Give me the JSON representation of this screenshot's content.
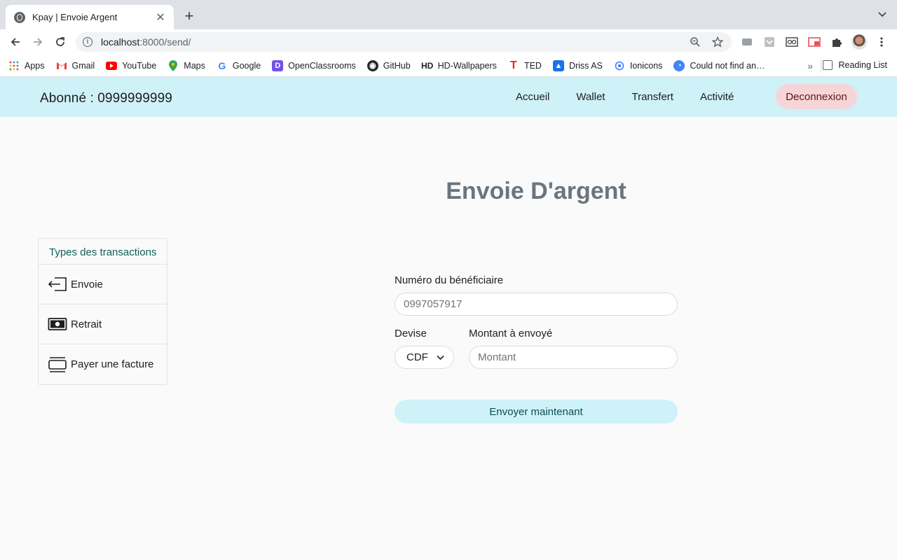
{
  "browser": {
    "tab_title": "Kpay | Envoie Argent",
    "tab_close": "✕",
    "new_tab": "+",
    "url_host": "localhost",
    "url_path": ":8000/send/",
    "bookmarks": [
      {
        "label": "Apps",
        "icon": "apps-grid-icon",
        "color": "#5f6368"
      },
      {
        "label": "Gmail",
        "icon": "gmail-icon",
        "color": "#ea4335"
      },
      {
        "label": "YouTube",
        "icon": "youtube-icon",
        "color": "#ff0000"
      },
      {
        "label": "Maps",
        "icon": "maps-icon",
        "color": "#34a853"
      },
      {
        "label": "Google",
        "icon": "google-icon",
        "color": "#4285f4"
      },
      {
        "label": "OpenClassrooms",
        "icon": "openclassrooms-icon",
        "color": "#7451eb"
      },
      {
        "label": "GitHub",
        "icon": "github-icon",
        "color": "#24292e"
      },
      {
        "label": "HD-Wallpapers",
        "icon": "hd-wallpapers-icon",
        "color": "#222222"
      },
      {
        "label": "TED",
        "icon": "ted-icon",
        "color": "#e62b1e"
      },
      {
        "label": "Driss AS",
        "icon": "driss-icon",
        "color": "#1a73e8"
      },
      {
        "label": "Ionicons",
        "icon": "ionicons-icon",
        "color": "#3880ff"
      },
      {
        "label": "Could not find an…",
        "icon": "could-not-find-icon",
        "color": "#4285f4"
      }
    ],
    "more": "»",
    "reading_list": "Reading List"
  },
  "app": {
    "subscriber": "Abonné : 0999999999",
    "nav": [
      "Accueil",
      "Wallet",
      "Transfert",
      "Activité"
    ],
    "logout": "Deconnexion",
    "page_title": "Envoie D'argent"
  },
  "sidebar": {
    "title": "Types des transactions",
    "items": [
      "Envoie",
      "Retrait",
      "Payer une facture"
    ]
  },
  "form": {
    "beneficiary_label": "Numéro du bénéficiaire",
    "beneficiary_placeholder": "0997057917",
    "currency_label": "Devise",
    "currency_value": "CDF",
    "amount_label": "Montant à envoyé",
    "amount_placeholder": "Montant",
    "submit": "Envoyer maintenant"
  },
  "colors": {
    "navbar": "#cff1f8",
    "logout_bg": "#f6d5d8",
    "title": "#6c757d",
    "submit_bg": "#cff1f8"
  }
}
